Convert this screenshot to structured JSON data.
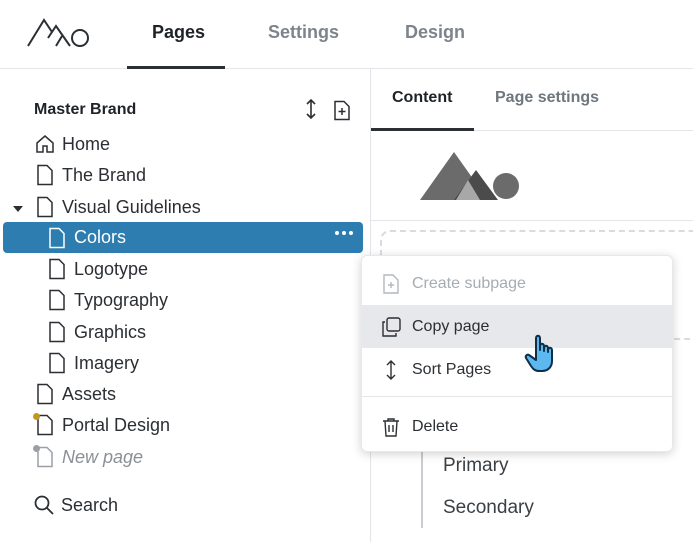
{
  "header": {
    "logo": "logo-mountains-icon",
    "tabs": [
      {
        "label": "Pages",
        "active": true
      },
      {
        "label": "Settings",
        "active": false
      },
      {
        "label": "Design",
        "active": false
      }
    ]
  },
  "sidebar": {
    "title": "Master Brand",
    "actions": [
      "sort-vertical-icon",
      "add-page-icon"
    ],
    "items": [
      {
        "label": "Home",
        "icon": "home-icon"
      },
      {
        "label": "The Brand",
        "icon": "page-icon"
      },
      {
        "label": "Visual Guidelines",
        "icon": "page-icon",
        "expanded": true
      },
      {
        "label": "Colors",
        "icon": "page-icon",
        "selected": true
      },
      {
        "label": "Logotype",
        "icon": "page-icon"
      },
      {
        "label": "Typography",
        "icon": "page-icon"
      },
      {
        "label": "Graphics",
        "icon": "page-icon"
      },
      {
        "label": "Imagery",
        "icon": "page-icon"
      },
      {
        "label": "Assets",
        "icon": "page-icon"
      },
      {
        "label": "Portal Design",
        "icon": "page-icon",
        "status_color": "#c19a1c"
      },
      {
        "label": "New page",
        "icon": "page-icon",
        "status_color": "#9aa0a6",
        "placeholder": true
      }
    ],
    "search_label": "Search"
  },
  "content": {
    "tabs": [
      {
        "label": "Content",
        "active": true
      },
      {
        "label": "Page settings",
        "active": false
      }
    ],
    "nav_items": [
      "Primary",
      "Secondary"
    ]
  },
  "context_menu": {
    "items": [
      {
        "label": "Create subpage",
        "icon": "add-page-icon",
        "disabled": true
      },
      {
        "label": "Copy page",
        "icon": "copy-icon",
        "hovered": true
      },
      {
        "label": "Sort Pages",
        "icon": "sort-vertical-icon"
      },
      {
        "label": "Delete",
        "icon": "trash-icon"
      }
    ]
  },
  "colors": {
    "accent": "#2e7db0",
    "text": "#2b2f33",
    "muted": "#7d848c",
    "status_yellow": "#c19a1c",
    "status_gray": "#9aa0a6"
  }
}
